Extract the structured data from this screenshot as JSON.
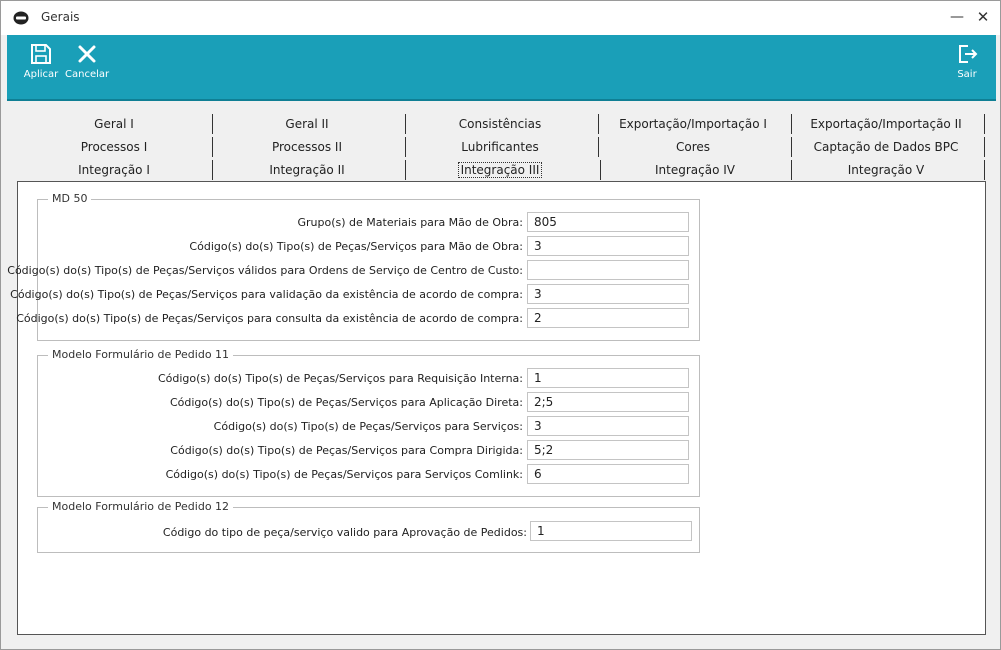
{
  "window": {
    "title": "Gerais",
    "minimize_icon": "minimize-icon",
    "close_icon": "close-icon",
    "minimize_glyph": "—",
    "close_glyph": "✕"
  },
  "toolbar": {
    "apply_label": "Aplicar",
    "cancel_label": "Cancelar",
    "exit_label": "Sair",
    "accent": "#1a9fb8"
  },
  "tabs": {
    "row1": [
      "Geral I",
      "Geral II",
      "Consistências",
      "Exportação/Importação I",
      "Exportação/Importação II"
    ],
    "row2": [
      "Processos I",
      "Processos II",
      "Lubrificantes",
      "Cores",
      "Captação de Dados BPC"
    ],
    "row3": [
      "Integração I",
      "Integração II",
      "Integração III",
      "Integração IV",
      "Integração V"
    ],
    "active": "Integração III"
  },
  "md50": {
    "title": "MD 50",
    "fields": [
      {
        "label": "Grupo(s) de Materiais para Mão de Obra:",
        "value": "805"
      },
      {
        "label": "Código(s) do(s) Tipo(s) de Peças/Serviços para Mão de Obra:",
        "value": "3"
      },
      {
        "label": "Código(s) do(s) Tipo(s) de Peças/Serviços válidos para Ordens de Serviço de Centro de Custo:",
        "value": ""
      },
      {
        "label": "Código(s) do(s) Tipo(s) de Peças/Serviços para validação da existência de acordo de compra:",
        "value": "3"
      },
      {
        "label": "Código(s) do(s) Tipo(s) de Peças/Serviços para consulta da existência de acordo de compra:",
        "value": "2"
      }
    ]
  },
  "modelo11": {
    "title": "Modelo Formulário de Pedido 11",
    "fields": [
      {
        "label": "Código(s) do(s) Tipo(s) de Peças/Serviços para Requisição Interna:",
        "value": "1"
      },
      {
        "label": "Código(s) do(s) Tipo(s) de Peças/Serviços para Aplicação Direta:",
        "value": "2;5"
      },
      {
        "label": "Código(s) do(s) Tipo(s) de Peças/Serviços para Serviços:",
        "value": "3"
      },
      {
        "label": "Código(s) do(s) Tipo(s) de Peças/Serviços para Compra Dirigida:",
        "value": "5;2"
      },
      {
        "label": "Código(s) do(s) Tipo(s) de Peças/Serviços para Serviços Comlink:",
        "value": "6"
      }
    ]
  },
  "modelo12": {
    "title": "Modelo Formulário de Pedido 12",
    "fields": [
      {
        "label": "Código do tipo de peça/serviço valido para Aprovação de Pedidos:",
        "value": "1"
      }
    ]
  }
}
